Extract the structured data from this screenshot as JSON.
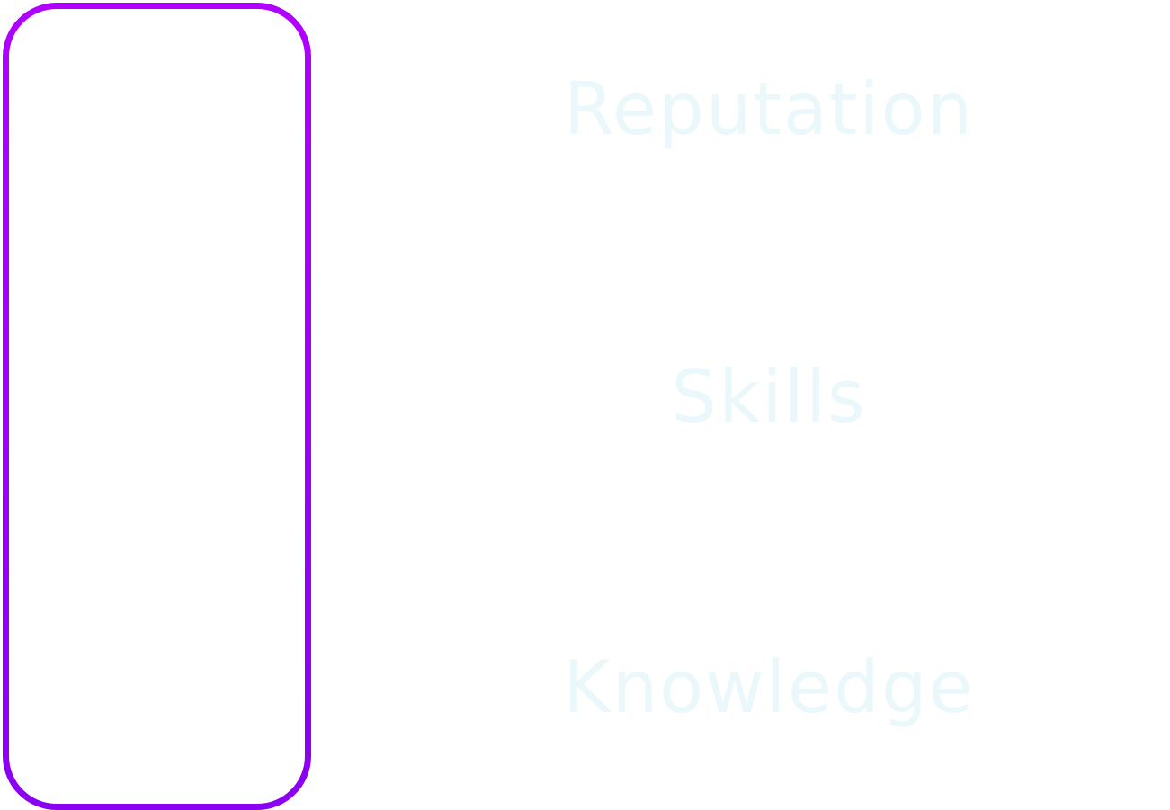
{
  "colors": {
    "frame_gradient_start": "#b000ff",
    "frame_gradient_end": "#8a00f0",
    "label_text": "#eaf7fb",
    "background": "#ffffff"
  },
  "labels": {
    "reputation": "Reputation",
    "skills": "Skills",
    "knowledge": "Knowledge"
  }
}
